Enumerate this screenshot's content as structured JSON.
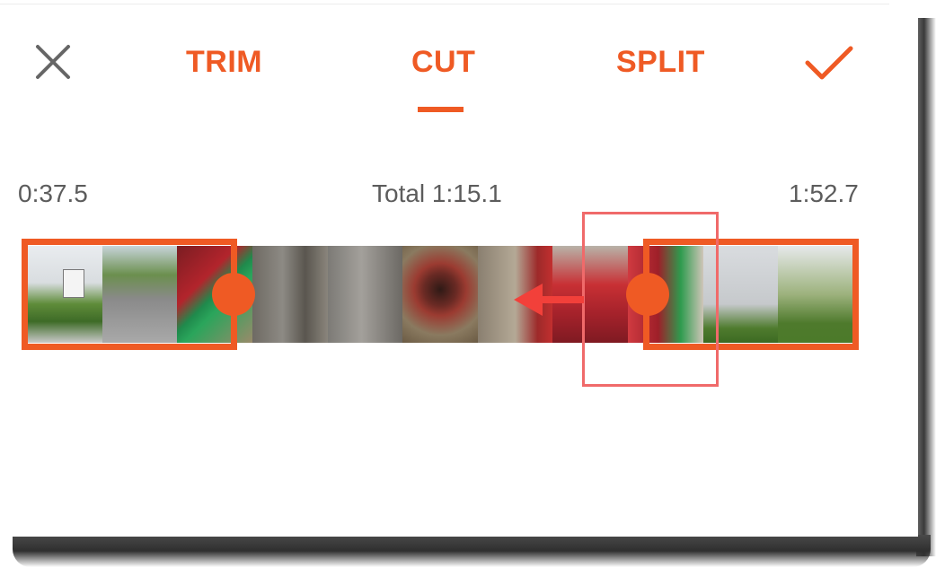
{
  "tabs": {
    "trim": "TRIM",
    "cut": "CUT",
    "split": "SPLIT",
    "active": "cut"
  },
  "icons": {
    "close": "close-icon",
    "confirm": "check-icon"
  },
  "timeline": {
    "start_time": "0:37.5",
    "total": "Total 1:15.1",
    "end_time": "1:52.7"
  },
  "colors": {
    "accent": "#ef5a24",
    "callout": "#f06a6a",
    "time_text": "#5c5c5c"
  },
  "filmstrip": {
    "frames": [
      "building-entrance",
      "road",
      "green-tag",
      "metal-pole",
      "metal-plate",
      "red-valve-wheel",
      "red-pipe",
      "red-hydrant",
      "red-hydrant-closeup",
      "shutter-wall",
      "shrubs"
    ]
  }
}
